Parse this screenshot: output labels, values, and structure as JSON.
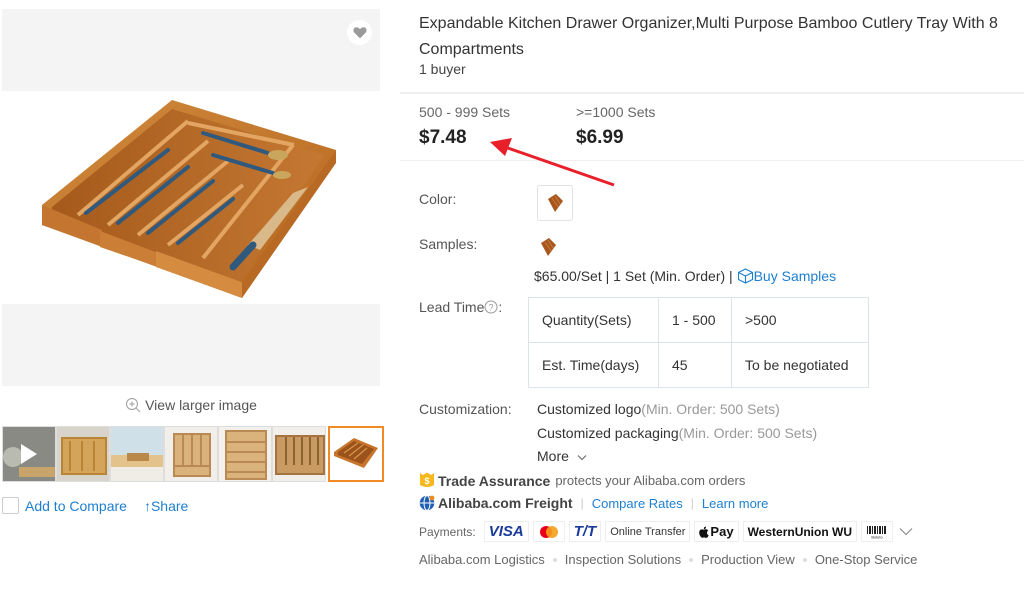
{
  "product": {
    "title": "Expandable Kitchen Drawer Organizer,Multi Purpose Bamboo Cutlery Tray With 8 Compartments",
    "buyers": "1 buyer"
  },
  "gallery": {
    "view_larger_label": "View larger image",
    "favorite_icon": "heart-icon",
    "thumbnails": [
      {
        "kind": "video",
        "label": "video-thumbnail"
      },
      {
        "kind": "image",
        "label": "organizer-top-view"
      },
      {
        "kind": "image",
        "label": "organizer-in-drawer"
      },
      {
        "kind": "image",
        "label": "organizer-front-view-1"
      },
      {
        "kind": "image",
        "label": "organizer-expanded"
      },
      {
        "kind": "image",
        "label": "organizer-front-view-2"
      },
      {
        "kind": "image",
        "label": "organizer-angled-view",
        "active": true
      }
    ],
    "add_to_compare_label": "Add to Compare",
    "share_label": "↑Share"
  },
  "pricing": {
    "tiers": [
      {
        "range": "500 - 999 Sets",
        "price": "$7.48"
      },
      {
        "range": ">=1000 Sets",
        "price": "$6.99"
      }
    ]
  },
  "attributes": {
    "color_label": "Color:",
    "samples_label": "Samples:",
    "sample_info": "$65.00/Set | 1 Set (Min. Order) | ",
    "buy_samples_label": "Buy Samples",
    "lead_time_label": "Lead Time",
    "lead_time_suffix": ":",
    "lead_time_table": [
      [
        "Quantity(Sets)",
        "1 - 500",
        ">500"
      ],
      [
        "Est. Time(days)",
        "45",
        "To be negotiated"
      ]
    ],
    "customization_label": "Customization:",
    "customization_options": [
      {
        "name": "Customized logo",
        "moq": "(Min. Order: 500 Sets)"
      },
      {
        "name": "Customized packaging",
        "moq": "(Min. Order: 500 Sets)"
      }
    ],
    "more_label": "More"
  },
  "services": {
    "trade_assurance_title": "Trade Assurance",
    "trade_assurance_desc": "protects your Alibaba.com orders",
    "freight_title": "Alibaba.com Freight",
    "compare_rates_label": "Compare Rates",
    "learn_more_label": "Learn more",
    "payments_label": "Payments:",
    "payment_methods": [
      "VISA",
      "Mastercard",
      "T/T",
      "Online Transfer",
      "Pay",
      "WesternUnion WU",
      "Boleto"
    ],
    "links": [
      "Alibaba.com Logistics",
      "Inspection Solutions",
      "Production View",
      "One-Stop Service"
    ]
  },
  "colors": {
    "link": "#1e7fd0",
    "active_thumb_border": "#f08a24",
    "annotation_arrow": "#e8202a"
  }
}
